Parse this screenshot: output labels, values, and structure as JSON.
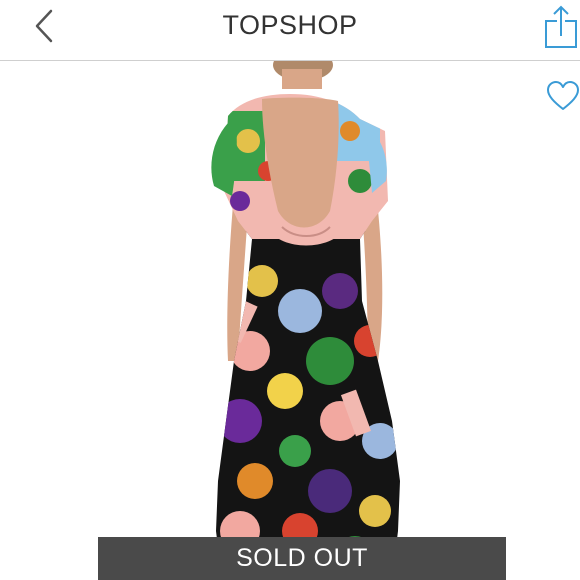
{
  "header": {
    "brand": "TOPSHOP",
    "back_icon": "chevron-left-icon",
    "share_icon": "share-icon"
  },
  "product": {
    "wishlist_icon": "heart-outline-icon",
    "image_alt": "Floral print open-back midi dress, back view",
    "status_banner": "SOLD OUT"
  },
  "colors": {
    "accent_blue": "#3a9bd6",
    "banner_bg": "#4a4a4a",
    "dress_black": "#141414",
    "skin": "#d9a688"
  }
}
